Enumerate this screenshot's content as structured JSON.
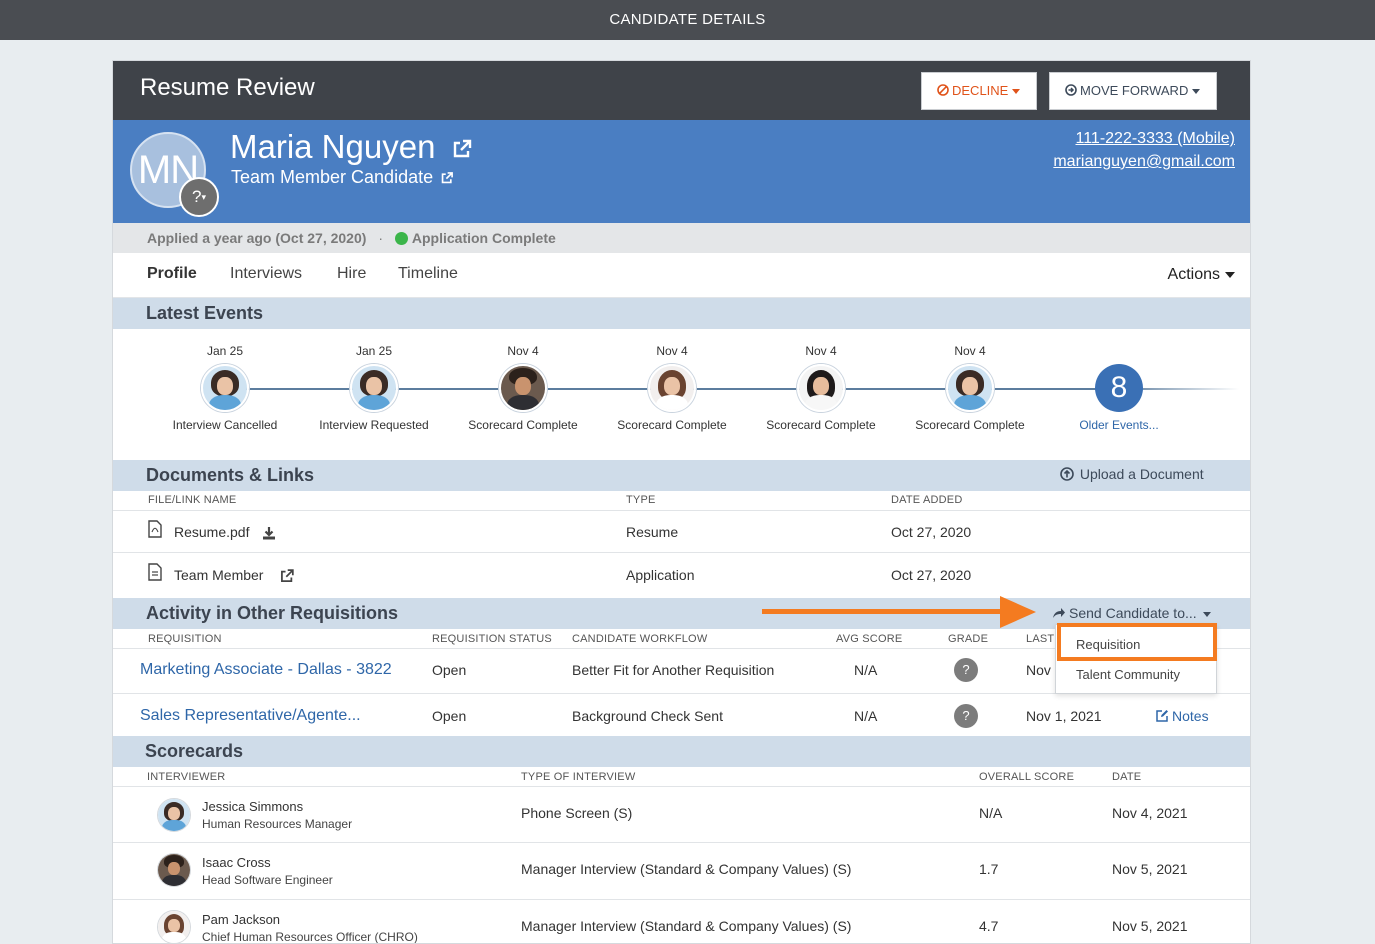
{
  "topbar": {
    "title": "CANDIDATE DETAILS"
  },
  "stage": {
    "title": "Resume Review",
    "decline_label": "DECLINE",
    "forward_label": "MOVE FORWARD"
  },
  "candidate": {
    "initials": "MN",
    "avatar_badge": "?",
    "name": "Maria Nguyen",
    "role": "Team Member Candidate",
    "phone": "111-222-3333 (Mobile)",
    "email": "marianguyen@gmail.com"
  },
  "status": {
    "applied": "Applied a year ago (Oct 27, 2020)",
    "separator": "·",
    "application": "Application Complete",
    "status_color": "#3bb54a"
  },
  "tabs": [
    {
      "label": "Profile",
      "active": true
    },
    {
      "label": "Interviews"
    },
    {
      "label": "Hire"
    },
    {
      "label": "Timeline"
    }
  ],
  "actions_label": "Actions",
  "latest_events": {
    "title": "Latest Events",
    "events": [
      {
        "date": "Jan 25",
        "label": "Interview Cancelled",
        "avatar": "woman-glasses"
      },
      {
        "date": "Jan 25",
        "label": "Interview Requested",
        "avatar": "woman-glasses"
      },
      {
        "date": "Nov 4",
        "label": "Scorecard Complete",
        "avatar": "man-beard"
      },
      {
        "date": "Nov 4",
        "label": "Scorecard Complete",
        "avatar": "woman-long-hair"
      },
      {
        "date": "Nov 4",
        "label": "Scorecard Complete",
        "avatar": "woman-dark-hair"
      },
      {
        "date": "Nov 4",
        "label": "Scorecard Complete",
        "avatar": "woman-glasses"
      }
    ],
    "older_count": "8",
    "older_label": "Older Events..."
  },
  "documents": {
    "title": "Documents & Links",
    "upload_label": "Upload a Document",
    "columns": [
      "FILE/LINK NAME",
      "TYPE",
      "DATE ADDED"
    ],
    "rows": [
      {
        "name": "Resume.pdf",
        "type": "Resume",
        "date": "Oct 27, 2020",
        "icon": "pdf-icon",
        "action_icon": "download-icon"
      },
      {
        "name": "Team Member",
        "type": "Application",
        "date": "Oct 27, 2020",
        "icon": "document-icon",
        "action_icon": "external-link-icon"
      }
    ]
  },
  "activity": {
    "title": "Activity in Other Requisitions",
    "send_label": "Send Candidate to...",
    "dropdown": [
      "Requisition",
      "Talent Community"
    ],
    "columns": [
      "REQUISITION",
      "REQUISITION STATUS",
      "CANDIDATE WORKFLOW",
      "AVG SCORE",
      "GRADE",
      "LAST A"
    ],
    "rows": [
      {
        "requisition": "Marketing Associate - Dallas - 3822",
        "status": "Open",
        "workflow": "Better Fit for Another Requisition",
        "score": "N/A",
        "grade": "?",
        "last": "Nov",
        "notes": ""
      },
      {
        "requisition": "Sales Representative/Agente...",
        "status": "Open",
        "workflow": "Background Check Sent",
        "score": "N/A",
        "grade": "?",
        "last": "Nov 1, 2021",
        "notes": "Notes"
      }
    ]
  },
  "scorecards": {
    "title": "Scorecards",
    "columns": [
      "INTERVIEWER",
      "TYPE OF INTERVIEW",
      "OVERALL SCORE",
      "DATE"
    ],
    "rows": [
      {
        "name": "Jessica Simmons",
        "title": "Human Resources Manager",
        "type": "Phone Screen (S)",
        "score": "N/A",
        "date": "Nov 4, 2021",
        "avatar": "woman-glasses"
      },
      {
        "name": "Isaac Cross",
        "title": "Head Software Engineer",
        "type": "Manager Interview (Standard & Company Values) (S)",
        "score": "1.7",
        "date": "Nov 5, 2021",
        "avatar": "man-beard"
      },
      {
        "name": "Pam Jackson",
        "title": "Chief Human Resources Officer (CHRO)",
        "type": "Manager Interview (Standard & Company Values) (S)",
        "score": "4.7",
        "date": "Nov 5, 2021",
        "avatar": "woman-long-hair"
      }
    ]
  },
  "colors": {
    "header_blue": "#4a7ec2",
    "section_bg": "#cfdce9",
    "accent_orange": "#f47b20",
    "decline_orange": "#e0531a",
    "link_blue": "#2e66a8"
  }
}
